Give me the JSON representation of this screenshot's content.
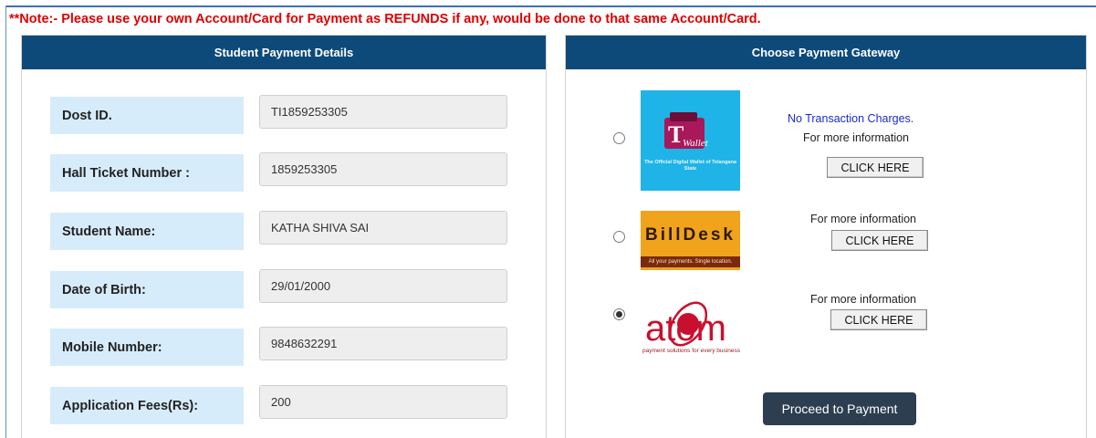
{
  "note": "**Note:- Please use your own Account/Card for Payment as REFUNDS if any, would be done to that same Account/Card.",
  "student_panel": {
    "title": "Student Payment Details",
    "fields": [
      {
        "label": "Dost ID.",
        "value": "TI1859253305"
      },
      {
        "label": "Hall Ticket Number :",
        "value": "1859253305"
      },
      {
        "label": "Student Name:",
        "value": "KATHA SHIVA SAI"
      },
      {
        "label": "Date of Birth:",
        "value": "29/01/2000"
      },
      {
        "label": "Mobile Number:",
        "value": "9848632291"
      },
      {
        "label": "Application Fees(Rs):",
        "value": "200"
      }
    ]
  },
  "gateway_panel": {
    "title": "Choose Payment Gateway",
    "gateways": [
      {
        "name": "T Wallet",
        "selected": false,
        "logo": {
          "letter": "T",
          "word": "Wallet",
          "subtitle": "The Official Digital Wallet of Telangana State"
        },
        "highlight": "No Transaction Charges.",
        "info": "For more information",
        "button": "CLICK HERE"
      },
      {
        "name": "BillDesk",
        "selected": false,
        "logo": {
          "word": "BillDesk",
          "subtitle": "All your payments. Single location."
        },
        "info": "For more information",
        "button": "CLICK HERE"
      },
      {
        "name": "atom",
        "selected": true,
        "logo": {
          "word": "atom",
          "subtitle": "payment solutions for every business"
        },
        "info": "For more information",
        "button": "CLICK HERE"
      }
    ],
    "proceed_button": "Proceed to Payment"
  },
  "colors": {
    "header_bg": "#0d4a7a",
    "label_bg": "#d7ecfb",
    "note_red": "#e00000",
    "highlight_blue": "#1a2bd0",
    "proceed_bg": "#2c3e50"
  }
}
